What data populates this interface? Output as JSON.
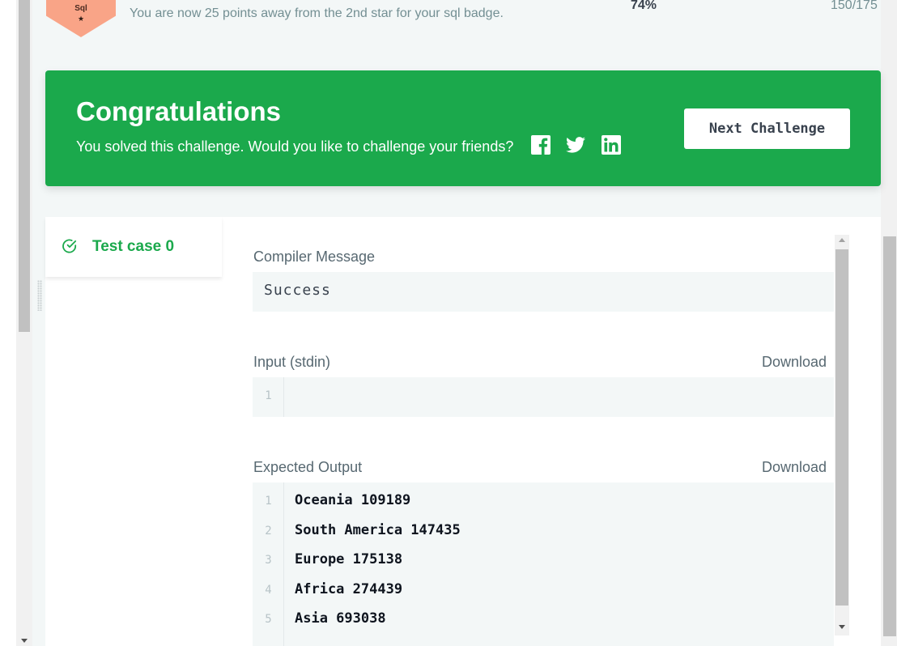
{
  "badge": {
    "name": "Sql",
    "star": "★",
    "message": "You are now 25 points away from the 2nd star for your sql badge.",
    "percent": "74%",
    "points": "150/175",
    "color": "#f9a487"
  },
  "congrats": {
    "title": "Congratulations",
    "text": "You solved this challenge. Would you like to challenge your friends?",
    "next_label": "Next Challenge",
    "social": [
      "facebook-icon",
      "twitter-icon",
      "linkedin-icon"
    ],
    "color": "#1ba94c"
  },
  "results": {
    "test_case_label": "Test case 0",
    "compiler_label": "Compiler Message",
    "compiler_message": "Success",
    "input_label": "Input (stdin)",
    "input_download": "Download",
    "input_lines": [
      {
        "num": "1",
        "text": ""
      }
    ],
    "expected_label": "Expected Output",
    "expected_download": "Download",
    "expected_lines": [
      {
        "num": "1",
        "text": "Oceania 109189"
      },
      {
        "num": "2",
        "text": "South America 147435"
      },
      {
        "num": "3",
        "text": "Europe 175138"
      },
      {
        "num": "4",
        "text": "Africa 274439"
      },
      {
        "num": "5",
        "text": "Asia 693038"
      }
    ]
  }
}
